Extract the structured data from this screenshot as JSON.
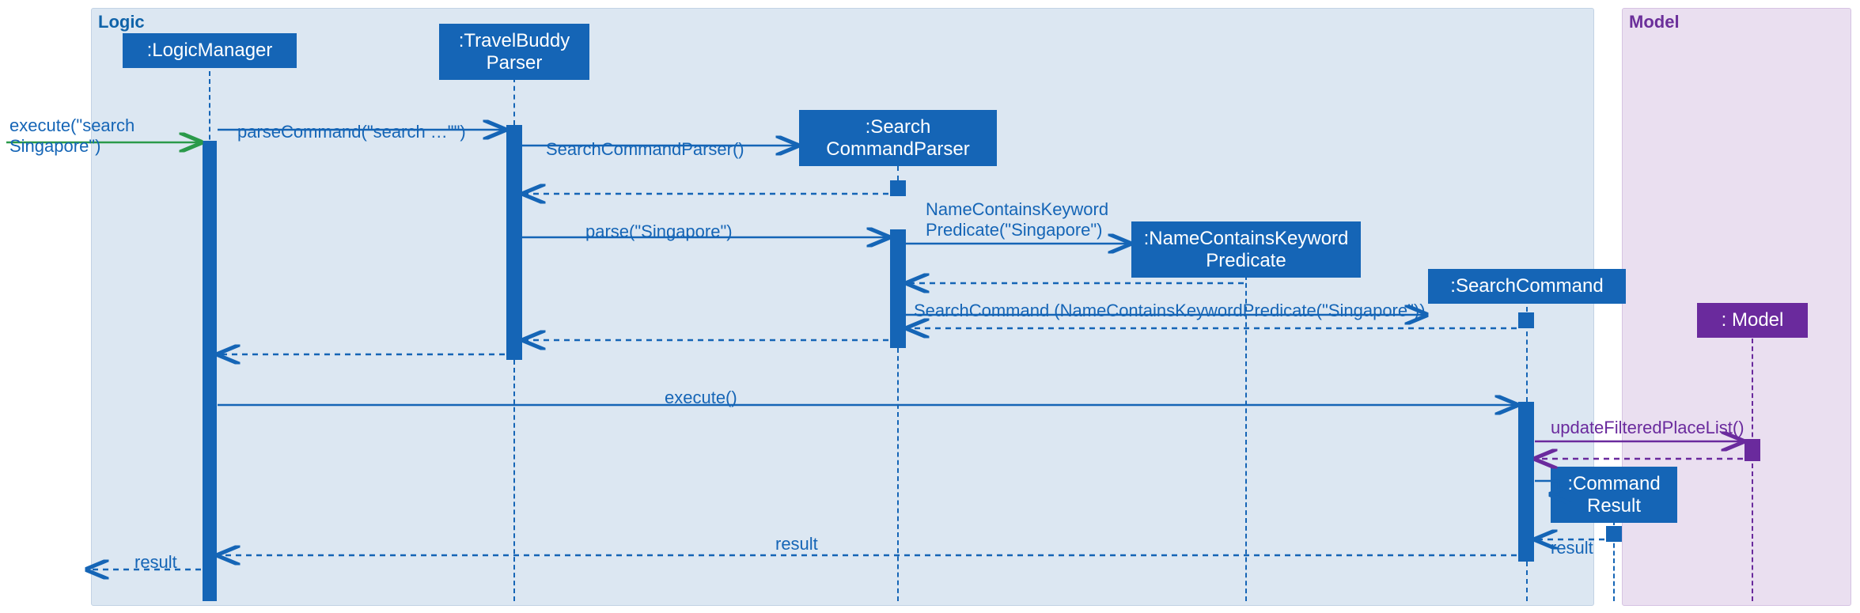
{
  "frames": {
    "logic": "Logic",
    "model": "Model"
  },
  "participants": {
    "logicManager": ":LogicManager",
    "travelBuddyParser": ":TravelBuddy\nParser",
    "searchCommandParser": ":Search\nCommandParser",
    "nameContainsKeywordPredicate": ":NameContainsKeyword\nPredicate",
    "searchCommand": ":SearchCommand",
    "commandResult": ":Command\nResult",
    "model": ": Model"
  },
  "messages": {
    "execute_in": "execute(\"search\nSingapore\")",
    "parseCommand": "parseCommand(\"search …\"\")",
    "searchCommandParserCtor": "SearchCommandParser()",
    "parse": "parse(\"Singapore\")",
    "nckPredicateCtor": "NameContainsKeyword\nPredicate(\"Singapore\")",
    "searchCommandCtor": "SearchCommand (NameContainsKeywordPredicate(\"Singapore\"))",
    "executeCall": "execute()",
    "updateFilteredPlaceList": "updateFilteredPlaceList()",
    "result1": "result",
    "result2": "result",
    "resultOut": "result"
  }
}
